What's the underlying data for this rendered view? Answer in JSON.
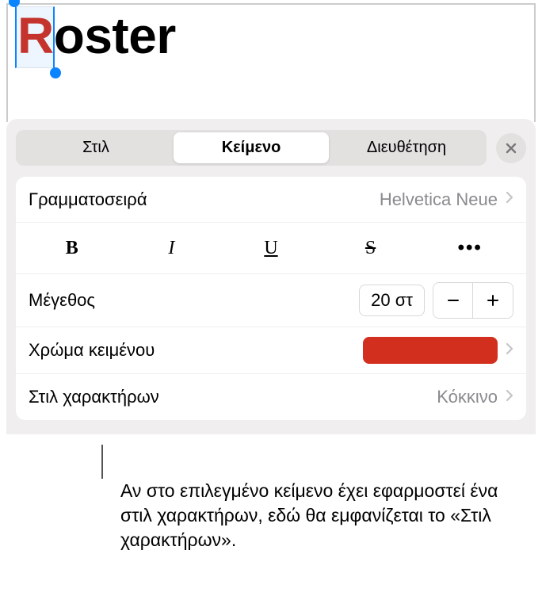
{
  "content": {
    "title_drop": "R",
    "title_rest": "oster"
  },
  "panel": {
    "tabs": {
      "style": "Στιλ",
      "text": "Κείμενο",
      "arrange": "Διευθέτηση"
    },
    "font": {
      "label": "Γραμματοσειρά",
      "value": "Helvetica Neue"
    },
    "format": {
      "bold": "B",
      "italic": "I",
      "underline": "U",
      "strike": "S",
      "more": "•••"
    },
    "size": {
      "label": "Μέγεθος",
      "value": "20 στ"
    },
    "color": {
      "label": "Χρώμα κειμένου",
      "hex": "#d32f1e"
    },
    "charstyle": {
      "label": "Στιλ χαρακτήρων",
      "value": "Κόκκινο"
    }
  },
  "caption": "Αν στο επιλεγμένο κείμενο έχει εφαρμοστεί ένα στιλ χαρακτήρων, εδώ θα εμφανίζεται το «Στιλ χαρακτήρων»."
}
